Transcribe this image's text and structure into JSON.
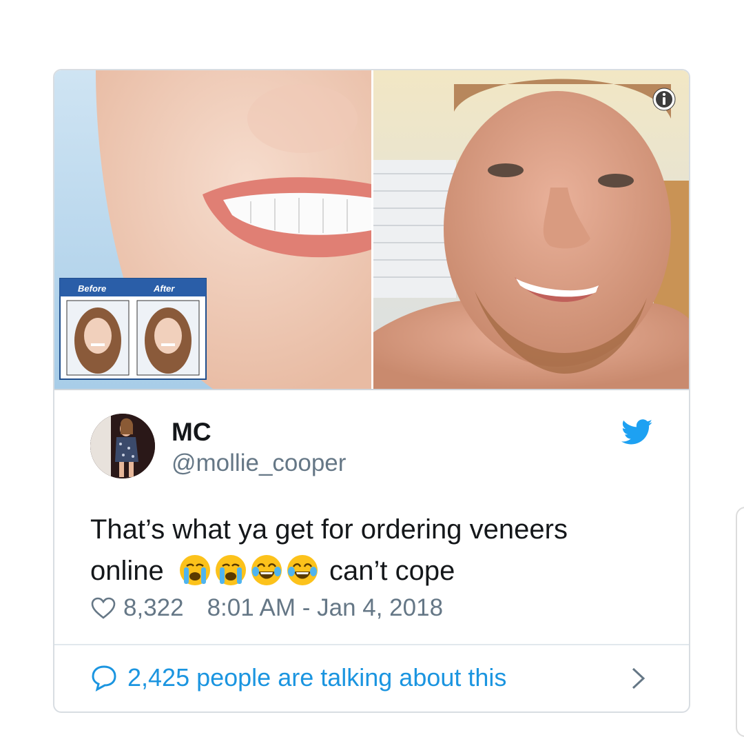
{
  "media": {
    "inset_labels": {
      "before": "Before",
      "after": "After"
    }
  },
  "author": {
    "name": "MC",
    "handle": "@mollie_cooper"
  },
  "tweet": {
    "text_line1": "That’s what ya get for ordering veneers",
    "text_line2_start": "online",
    "emojis": [
      "loudly-crying-face",
      "loudly-crying-face",
      "face-with-tears-of-joy",
      "face-with-tears-of-joy"
    ],
    "text_line2_end": "can’t cope"
  },
  "meta": {
    "likes": "8,322",
    "timestamp": "8:01 AM - Jan 4, 2018"
  },
  "footer": {
    "talking_text": "2,425 people are talking about this"
  },
  "colors": {
    "accent": "#1b95e0",
    "secondary_text": "#657786",
    "border": "#d8dde2",
    "twitter_blue": "#1da1f2"
  },
  "icons": [
    "info-icon",
    "twitter-bird-icon",
    "heart-icon",
    "speech-bubble-icon",
    "chevron-right-icon"
  ]
}
